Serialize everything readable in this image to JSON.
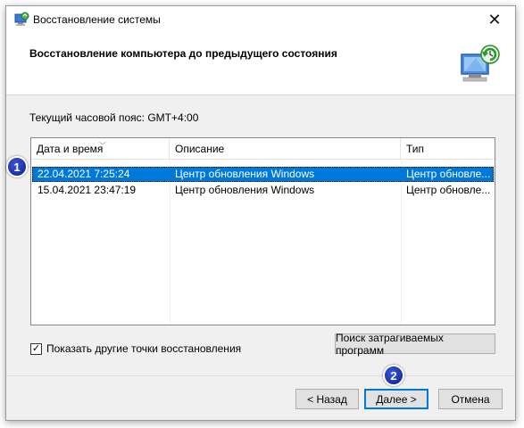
{
  "window": {
    "title": "Восстановление системы",
    "close_glyph": "✕"
  },
  "header": {
    "title": "Восстановление компьютера до предыдущего состояния",
    "icon": "system-restore-icon"
  },
  "timezone": {
    "label": "Текущий часовой пояс: GMT+4:00"
  },
  "table": {
    "columns": [
      "Дата и время",
      "Описание",
      "Тип"
    ],
    "rows": [
      {
        "date": "22.04.2021 7:25:24",
        "description": "Центр обновления Windows",
        "type": "Центр обновле...",
        "selected": true
      },
      {
        "date": "15.04.2021 23:47:19",
        "description": "Центр обновления Windows",
        "type": "Центр обновле...",
        "selected": false
      }
    ]
  },
  "options": {
    "show_more_label": "Показать другие точки восстановления",
    "show_more_checked": true,
    "scan_button": "Поиск затрагиваемых программ"
  },
  "buttons": {
    "back": "< Назад",
    "next": "Далее >",
    "cancel": "Отмена"
  },
  "annotations": {
    "badge1": "1",
    "badge2": "2"
  },
  "colors": {
    "selection": "#0078d7",
    "badge": "#1a33b8"
  }
}
